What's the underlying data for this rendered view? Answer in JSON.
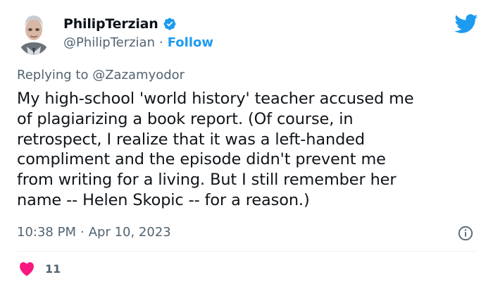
{
  "author": {
    "display_name": "PhilipTerzian",
    "handle": "@PhilipTerzian",
    "separator": "·",
    "follow_label": "Follow",
    "verified_icon": "verified-badge-icon"
  },
  "reply": {
    "prefix": "Replying to",
    "mention": "@Zazamyodor"
  },
  "tweet": {
    "text": "My high-school 'world history' teacher accused me\nof plagiarizing a book report. (Of course, in\nretrospect, I realize that it was a left-handed\ncompliment and the episode didn't prevent me\nfrom writing for a living. But I still remember her\nname -- Helen Skopic -- for a reason.)"
  },
  "meta": {
    "time": "10:38 PM",
    "separator": "·",
    "date": "Apr 10, 2023"
  },
  "actions": {
    "like_count": "11"
  },
  "colors": {
    "accent": "#1d9bf0",
    "like": "#f91880",
    "muted": "#536471",
    "text": "#0f1419"
  }
}
